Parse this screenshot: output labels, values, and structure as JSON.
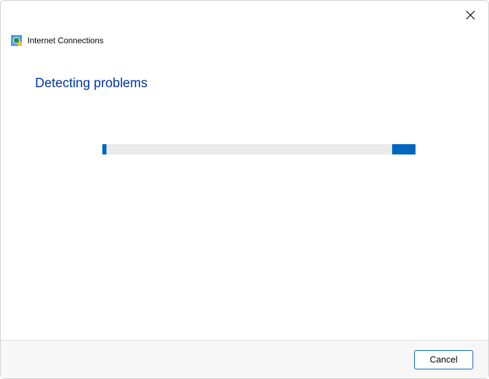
{
  "window": {
    "title": "Internet Connections",
    "close_icon": "close"
  },
  "main": {
    "heading": "Detecting problems"
  },
  "progress": {
    "state": "indeterminate"
  },
  "footer": {
    "cancel_label": "Cancel"
  },
  "colors": {
    "accent": "#0067c0",
    "heading": "#0033aa",
    "footer_bg": "#f7f7f7",
    "track": "#eaeaea"
  }
}
